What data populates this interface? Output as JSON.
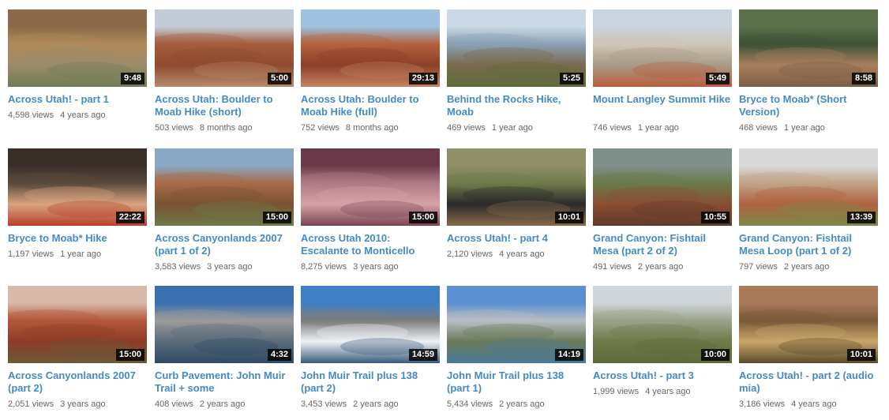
{
  "videos": [
    {
      "title": "Across Utah! - part 1",
      "views": "4,598 views",
      "ago": "4 years ago",
      "duration": "9:48",
      "colors": [
        "#8a6a48",
        "#b08a5a",
        "#9c8c6a",
        "#6f7a55"
      ]
    },
    {
      "title": "Across Utah: Boulder to Moab Hike (short)",
      "views": "503 views",
      "ago": "8 months ago",
      "duration": "5:00",
      "colors": [
        "#c3cbd6",
        "#a55c3c",
        "#8f4b31",
        "#b78a6c"
      ]
    },
    {
      "title": "Across Utah: Boulder to Moab Hike (full)",
      "views": "752 views",
      "ago": "8 months ago",
      "duration": "29:13",
      "colors": [
        "#9ec2df",
        "#b4603e",
        "#8c3f28",
        "#c48463"
      ]
    },
    {
      "title": "Behind the Rocks Hike, Moab",
      "views": "469 views",
      "ago": "1 year ago",
      "duration": "5:25",
      "colors": [
        "#cbd9e6",
        "#8aa0b4",
        "#7a6a4e",
        "#5c6b3a"
      ]
    },
    {
      "title": "Mount Langley Summit Hike",
      "views": "746 views",
      "ago": "1 year ago",
      "duration": "5:49",
      "colors": [
        "#c9d4de",
        "#cfc6b6",
        "#a89a86",
        "#b85d3b"
      ]
    },
    {
      "title": "Bryce to Moab* (Short Version)",
      "views": "468 views",
      "ago": "1 year ago",
      "duration": "8:58",
      "colors": [
        "#5a6f4a",
        "#3f5236",
        "#a87f5e",
        "#7a5e45"
      ]
    },
    {
      "title": "Bryce to Moab* Hike",
      "views": "1,197 views",
      "ago": "1 year ago",
      "duration": "22:22",
      "colors": [
        "#3a2f28",
        "#5a4a3c",
        "#d9a37e",
        "#b8412e"
      ]
    },
    {
      "title": "Across Canyonlands 2007 (part 1 of 2)",
      "views": "3,583 views",
      "ago": "3 years ago",
      "duration": "15:00",
      "colors": [
        "#8aa8c4",
        "#a86a48",
        "#7a5233",
        "#6d7a4a"
      ]
    },
    {
      "title": "Across Utah 2010: Escalante to Monticello",
      "views": "8,275 views",
      "ago": "3 years ago",
      "duration": "15:00",
      "colors": [
        "#6a3a4a",
        "#b07a86",
        "#d6a2a6",
        "#7a4452"
      ]
    },
    {
      "title": "Across Utah! - part 4",
      "views": "2,120 views",
      "ago": "4 years ago",
      "duration": "10:01",
      "colors": [
        "#8f8f6a",
        "#6f7a4a",
        "#2a2a2a",
        "#8a6a4a"
      ]
    },
    {
      "title": "Grand Canyon: Fishtail Mesa (part 2 of 2)",
      "views": "491 views",
      "ago": "2 years ago",
      "duration": "10:55",
      "colors": [
        "#7f8f8a",
        "#6a7a4a",
        "#8a4e33",
        "#5e3a2a"
      ]
    },
    {
      "title": "Grand Canyon: Fishtail Mesa Loop (part 1 of 2)",
      "views": "797 views",
      "ago": "2 years ago",
      "duration": "13:39",
      "colors": [
        "#d9d9d9",
        "#c1a386",
        "#b0613f",
        "#7a8a4a"
      ]
    },
    {
      "title": "Across Canyonlands 2007 (part 2)",
      "views": "2,051 views",
      "ago": "3 years ago",
      "duration": "15:00",
      "colors": [
        "#d8b8a8",
        "#b3583a",
        "#8e3b26",
        "#6a5a3a"
      ]
    },
    {
      "title": "Curb Pavement: John Muir Trail + some",
      "views": "408 views",
      "ago": "2 years ago",
      "duration": "4:32",
      "colors": [
        "#3c6fb0",
        "#9a9a9a",
        "#5b6b7a",
        "#2e4a66"
      ]
    },
    {
      "title": "John Muir Trail plus 138 (part 2)",
      "views": "3,453 views",
      "ago": "2 years ago",
      "duration": "14:59",
      "colors": [
        "#3f7fc6",
        "#7d7d7d",
        "#eef2f5",
        "#3a5a7a"
      ]
    },
    {
      "title": "John Muir Trail plus 138 (part 1)",
      "views": "5,434 views",
      "ago": "2 years ago",
      "duration": "14:19",
      "colors": [
        "#5a8fd0",
        "#b7bcc3",
        "#6a7a5a",
        "#4a7a9a"
      ]
    },
    {
      "title": "Across Utah! - part 3",
      "views": "1,999 views",
      "ago": "4 years ago",
      "duration": "10:00",
      "colors": [
        "#cfd5d8",
        "#9aa38a",
        "#6f7a4a",
        "#5c6a3a"
      ]
    },
    {
      "title": "Across Utah! - part 2 (audio mia)",
      "views": "3,186 views",
      "ago": "4 years ago",
      "duration": "10:01",
      "colors": [
        "#a87a5a",
        "#7a5a3a",
        "#c9a66a",
        "#5a4a2a"
      ]
    }
  ]
}
